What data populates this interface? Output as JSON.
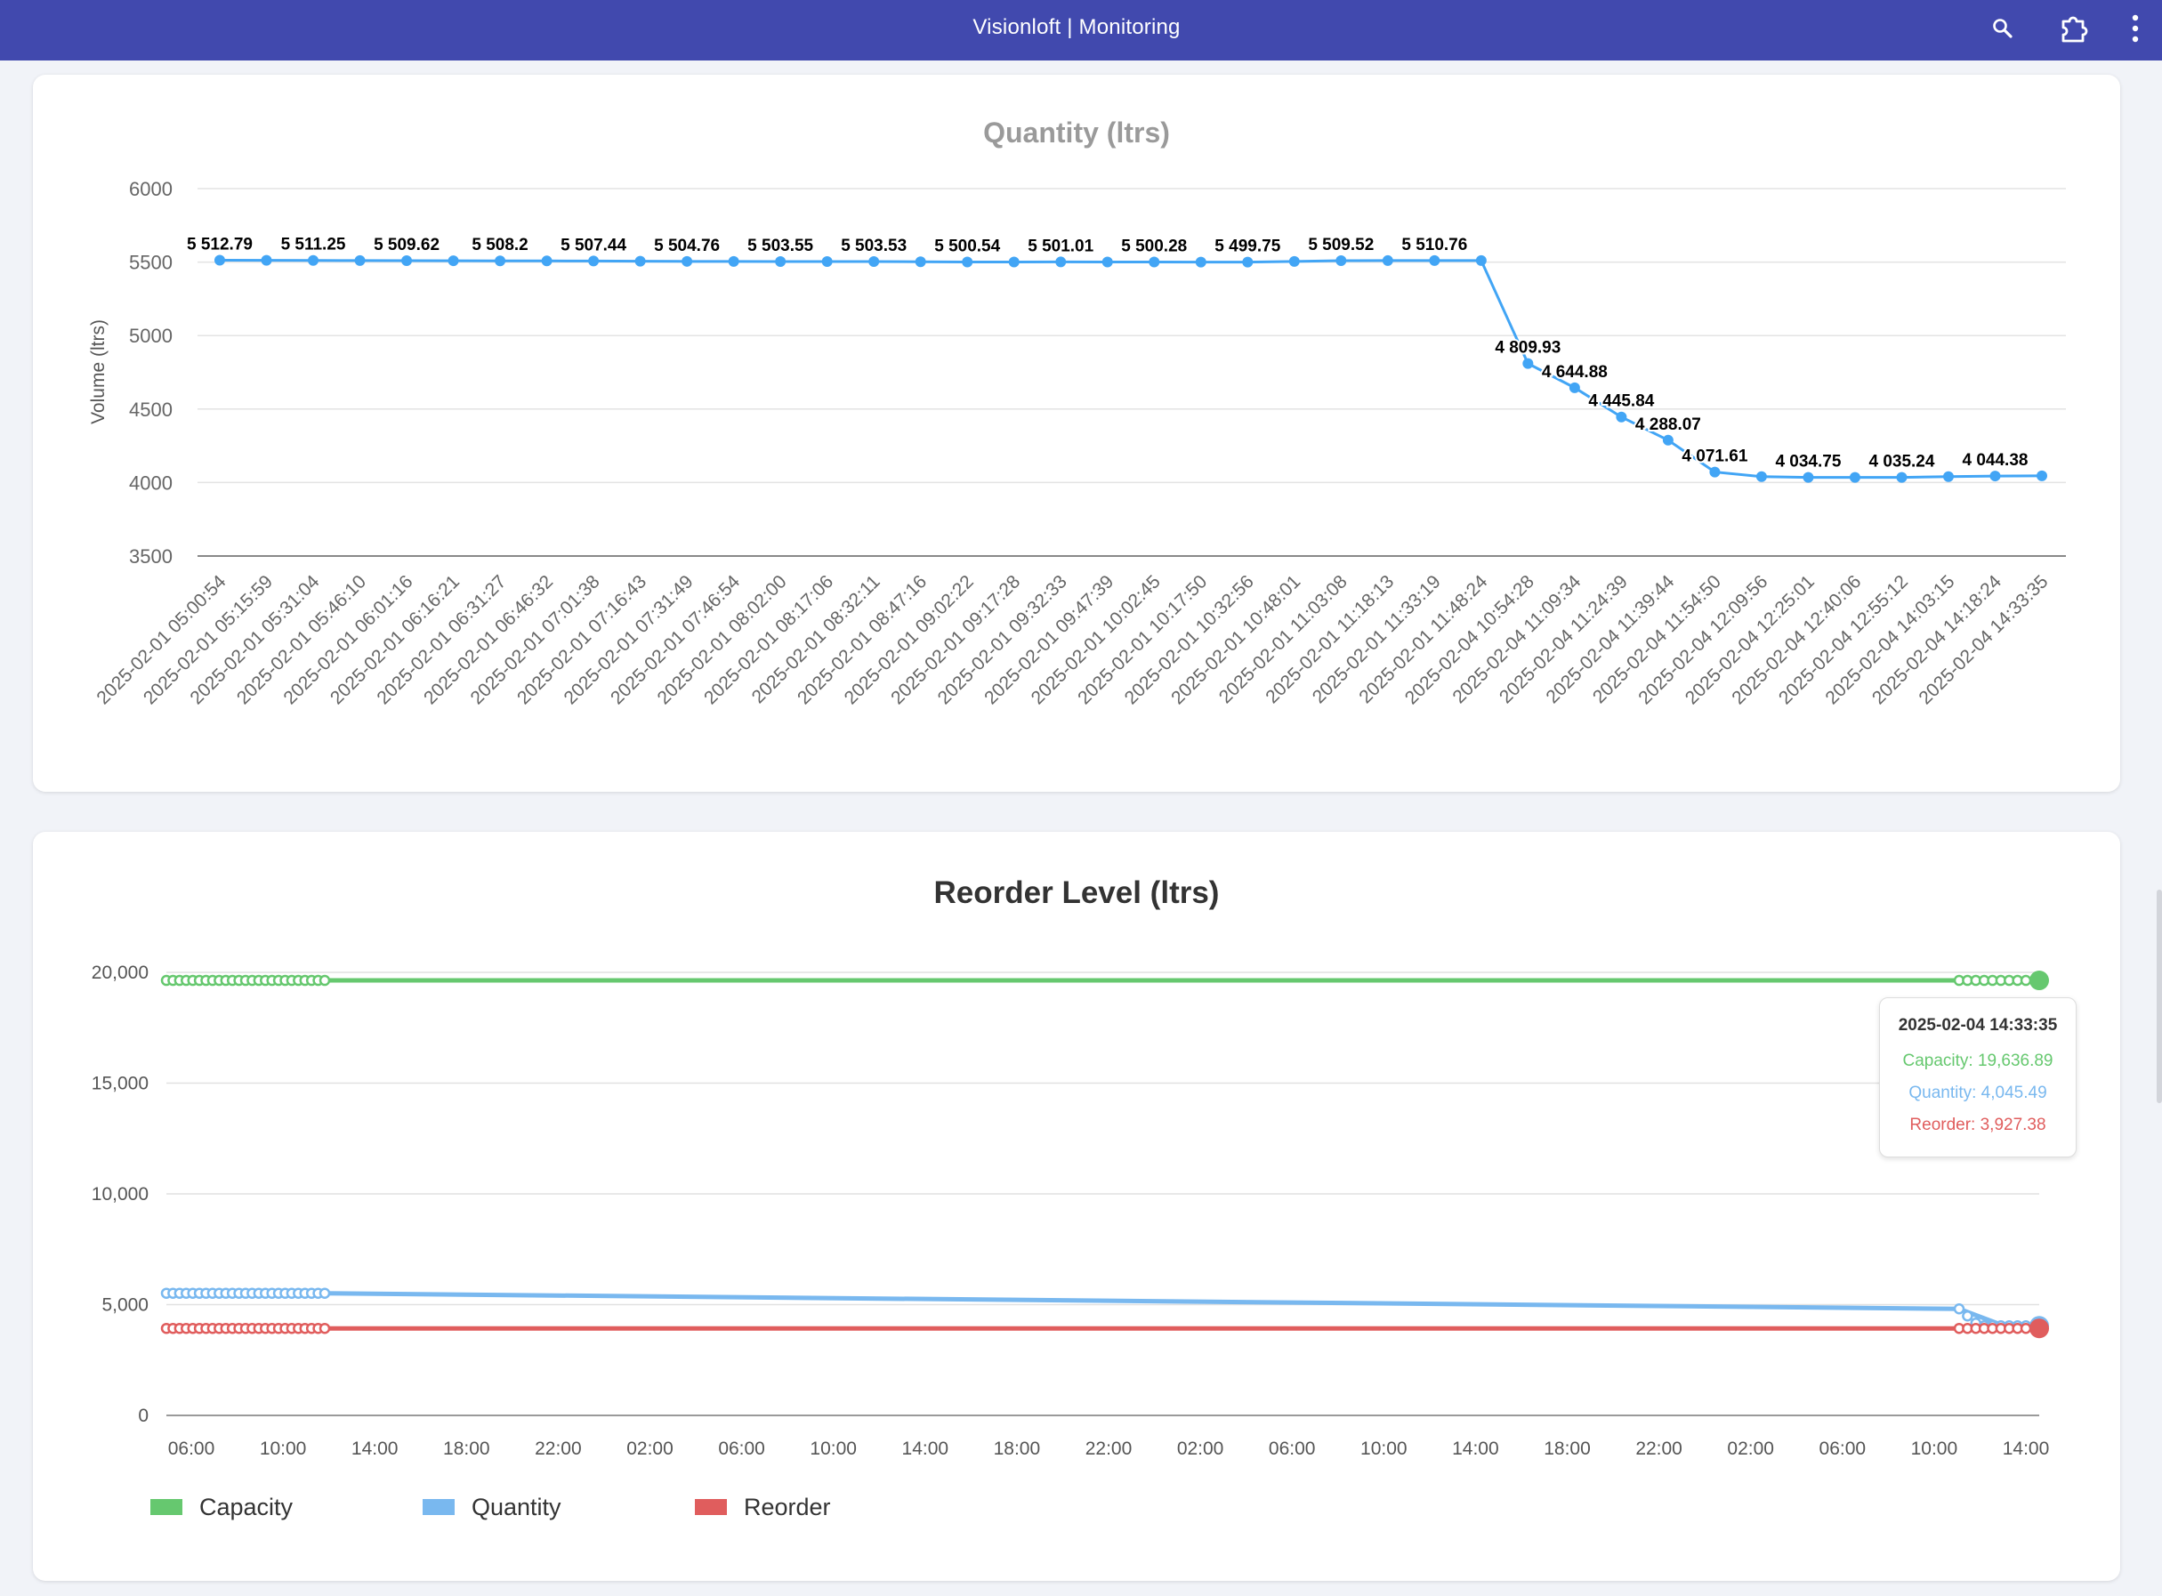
{
  "header": {
    "title": "Visionloft | Monitoring",
    "icons": [
      "search-icon",
      "extension-icon",
      "more-vert-icon"
    ],
    "background": "#4149ae"
  },
  "chart1": {
    "chart_data": {
      "type": "line",
      "title": "Quantity (ltrs)",
      "ylabel": "Volume (ltrs)",
      "xlabel": "",
      "ylim": [
        3500,
        6000
      ],
      "yticks": [
        "6000",
        "5500",
        "5000",
        "4500",
        "4000",
        "3500"
      ],
      "grid": true,
      "color": "#42a5f5",
      "categories": [
        "2025-02-01 05:00:54",
        "2025-02-01 05:15:59",
        "2025-02-01 05:31:04",
        "2025-02-01 05:46:10",
        "2025-02-01 06:01:16",
        "2025-02-01 06:16:21",
        "2025-02-01 06:31:27",
        "2025-02-01 06:46:32",
        "2025-02-01 07:01:38",
        "2025-02-01 07:16:43",
        "2025-02-01 07:31:49",
        "2025-02-01 07:46:54",
        "2025-02-01 08:02:00",
        "2025-02-01 08:17:06",
        "2025-02-01 08:32:11",
        "2025-02-01 08:47:16",
        "2025-02-01 09:02:22",
        "2025-02-01 09:17:28",
        "2025-02-01 09:32:33",
        "2025-02-01 09:47:39",
        "2025-02-01 10:02:45",
        "2025-02-01 10:17:50",
        "2025-02-01 10:32:56",
        "2025-02-01 10:48:01",
        "2025-02-01 11:03:08",
        "2025-02-01 11:18:13",
        "2025-02-01 11:33:19",
        "2025-02-01 11:48:24",
        "2025-02-04 10:54:28",
        "2025-02-04 11:09:34",
        "2025-02-04 11:24:39",
        "2025-02-04 11:39:44",
        "2025-02-04 11:54:50",
        "2025-02-04 12:09:56",
        "2025-02-04 12:25:01",
        "2025-02-04 12:40:06",
        "2025-02-04 12:55:12",
        "2025-02-04 14:03:15",
        "2025-02-04 14:18:24",
        "2025-02-04 14:33:35"
      ],
      "values": [
        5512.79,
        5511.9,
        5511.25,
        5510.4,
        5509.62,
        5508.9,
        5508.2,
        5507.8,
        5507.44,
        5506.1,
        5504.76,
        5504.1,
        5503.55,
        5503.5,
        5503.53,
        5502.0,
        5500.54,
        5500.8,
        5501.01,
        5500.6,
        5500.28,
        5500.0,
        5499.75,
        5504.6,
        5509.52,
        5510.1,
        5510.76,
        5510.5,
        4809.93,
        4644.88,
        4445.84,
        4288.07,
        4071.61,
        4040.1,
        4034.75,
        4035.0,
        4035.24,
        4040.0,
        4044.38,
        4045.49
      ],
      "data_labels": [
        "5 512.79",
        "",
        "5 511.25",
        "",
        "5 509.62",
        "",
        "5 508.2",
        "",
        "5 507.44",
        "",
        "5 504.76",
        "",
        "5 503.55",
        "",
        "5 503.53",
        "",
        "5 500.54",
        "",
        "5 501.01",
        "",
        "5 500.28",
        "",
        "5 499.75",
        "",
        "5 509.52",
        "",
        "5 510.76",
        "",
        "4 809.93",
        "4 644.88",
        "4 445.84",
        "4 288.07",
        "4 071.61",
        "",
        "4 034.75",
        "",
        "4 035.24",
        "",
        "4 044.38",
        ""
      ]
    }
  },
  "chart2": {
    "chart_data": {
      "type": "line",
      "title": "Reorder Level (ltrs)",
      "ylim": [
        0,
        20000
      ],
      "yticks": [
        "20,000",
        "15,000",
        "10,000",
        "5,000",
        "0"
      ],
      "xticks": [
        "06:00",
        "10:00",
        "14:00",
        "18:00",
        "22:00",
        "02:00",
        "06:00",
        "10:00",
        "14:00",
        "18:00",
        "22:00",
        "02:00",
        "06:00",
        "10:00",
        "14:00",
        "18:00",
        "22:00",
        "02:00",
        "06:00",
        "10:00",
        "14:00"
      ],
      "xrange": [
        "2025-02-01 05:00",
        "2025-02-04 14:40"
      ],
      "legend_position": "bottom-left",
      "series": [
        {
          "name": "Capacity",
          "color": "#66c86f",
          "values_start": 19636.89,
          "values_end": 19636.89
        },
        {
          "name": "Quantity",
          "color": "#79b8ef",
          "values_start": 5512.79,
          "values_end": 4045.49
        },
        {
          "name": "Reorder",
          "color": "#e05d5d",
          "values_start": 3927.38,
          "values_end": 3927.38
        }
      ]
    },
    "legend": {
      "capacity": "Capacity",
      "quantity": "Quantity",
      "reorder": "Reorder"
    },
    "tooltip": {
      "time": "2025-02-04 14:33:35",
      "capacity": "Capacity: 19,636.89",
      "quantity": "Quantity: 4,045.49",
      "reorder": "Reorder: 3,927.38"
    }
  }
}
